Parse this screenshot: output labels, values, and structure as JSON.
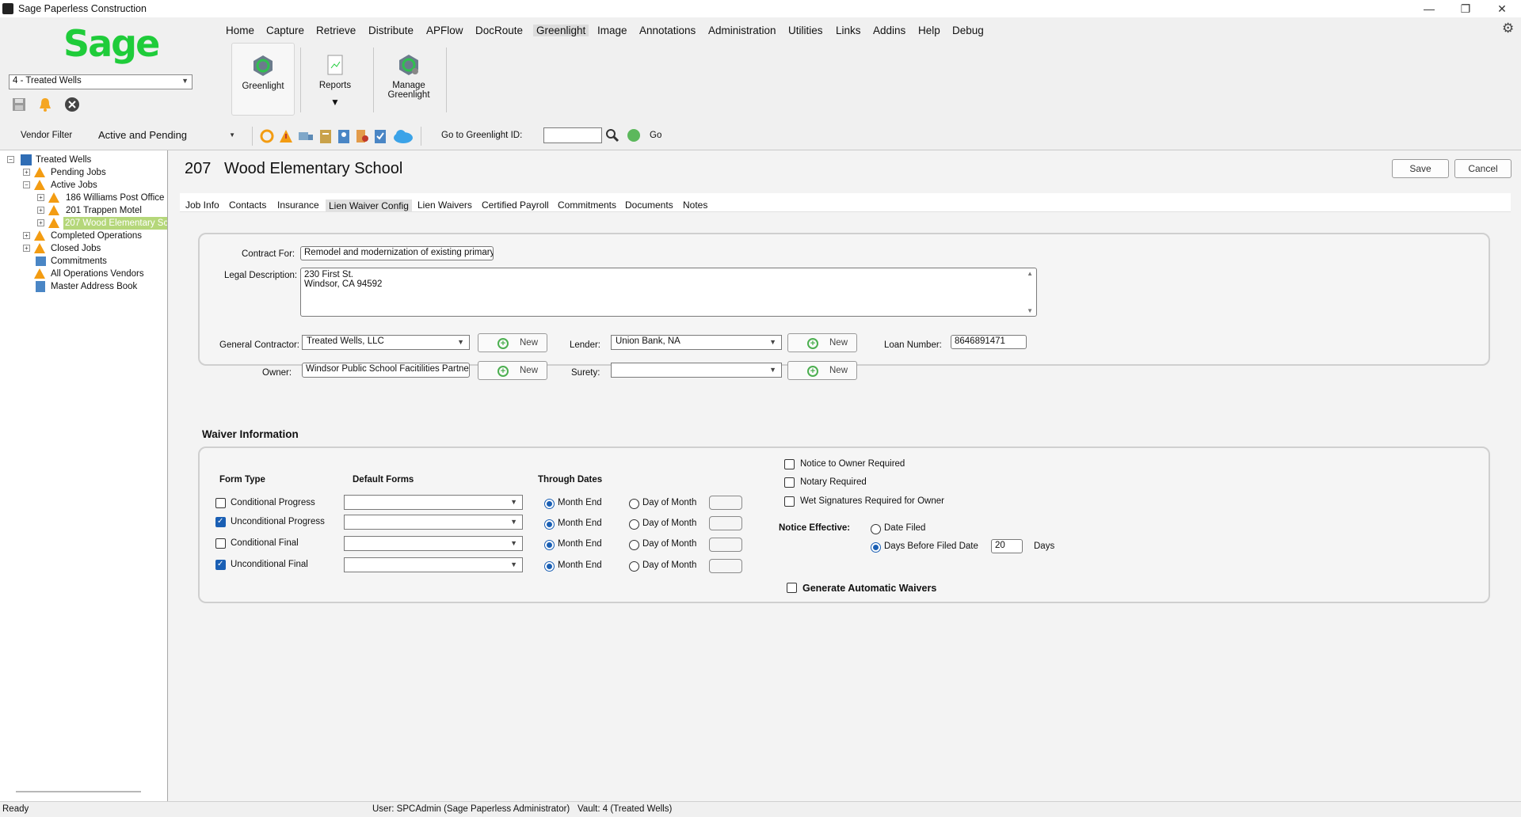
{
  "window": {
    "title": "Sage Paperless Construction",
    "controls": {
      "minimize": "—",
      "restore": "❐",
      "close": "✕"
    }
  },
  "brand": {
    "logo_text": "Sage",
    "color": "#1fcc3a"
  },
  "vault_select": {
    "value": "4 - Treated Wells"
  },
  "menu": [
    "Home",
    "Capture",
    "Retrieve",
    "Distribute",
    "APFlow",
    "DocRoute",
    "Greenlight",
    "Image",
    "Annotations",
    "Administration",
    "Utilities",
    "Links",
    "Addins",
    "Help",
    "Debug"
  ],
  "ribbon": {
    "greenlight": "Greenlight",
    "reports": "Reports",
    "manage_line1": "Manage",
    "manage_line2": "Greenlight"
  },
  "toolbar": {
    "vendor_filter_label": "Vendor Filter",
    "vendor_filter_value": "Active and Pending",
    "goto_label": "Go to Greenlight ID:",
    "goto_value": "",
    "go_label": "Go"
  },
  "tree": {
    "root": "Treated Wells",
    "pending": "Pending Jobs",
    "active": "Active Jobs",
    "job186": "186  Williams Post Office",
    "job201": "201  Trappen Motel",
    "job207": "207  Wood Elementary Sc",
    "completed": "Completed Operations",
    "closed": "Closed Jobs",
    "commitments": "Commitments",
    "vendors": "All Operations Vendors",
    "address_book": "Master Address Book"
  },
  "job": {
    "number": "207",
    "name": "Wood Elementary School"
  },
  "actions": {
    "save": "Save",
    "cancel": "Cancel"
  },
  "tabs": [
    "Job Info",
    "Contacts",
    "Insurance",
    "Lien Waiver Config",
    "Lien Waivers",
    "Certified Payroll",
    "Commitments",
    "Documents",
    "Notes"
  ],
  "contract": {
    "contract_for_label": "Contract For:",
    "contract_for": "Remodel and modernization of existing primary school",
    "legal_label": "Legal Description:",
    "legal_line1": "230 First St.",
    "legal_line2": "Windsor, CA  94592",
    "gc_label": "General Contractor:",
    "gc_value": "Treated Wells, LLC",
    "owner_label": "Owner:",
    "owner_value": "Windsor Public School Facitilities Partners",
    "lender_label": "Lender:",
    "lender_value": "Union Bank, NA",
    "surety_label": "Surety:",
    "surety_value": "",
    "loan_label": "Loan Number:",
    "loan_value": "8646891471",
    "new_label": "New"
  },
  "waiver": {
    "section_title": "Waiver Information",
    "col_form_type": "Form Type",
    "col_default_forms": "Default Forms",
    "col_through_dates": "Through Dates",
    "rows": [
      {
        "label": "Conditional Progress",
        "checked": false,
        "month_end": "Month End",
        "day_of_month": "Day of Month"
      },
      {
        "label": "Unconditional Progress",
        "checked": true,
        "month_end": "Month End",
        "day_of_month": "Day of Month"
      },
      {
        "label": "Conditional Final",
        "checked": false,
        "month_end": "Month End",
        "day_of_month": "Day of Month"
      },
      {
        "label": "Unconditional Final",
        "checked": true,
        "month_end": "Month End",
        "day_of_month": "Day of Month"
      }
    ],
    "notice_owner": "Notice to Owner Required",
    "notary": "Notary Required",
    "wet_sig": "Wet Signatures Required for Owner",
    "notice_effective_label": "Notice Effective:",
    "date_filed": "Date Filed",
    "days_before": "Days Before Filed Date",
    "days_value": "20",
    "days_unit": "Days",
    "generate": "Generate Automatic Waivers"
  },
  "status": {
    "ready": "Ready",
    "user": "User: SPCAdmin (Sage Paperless Administrator)",
    "vault": "Vault: 4 (Treated Wells)"
  }
}
